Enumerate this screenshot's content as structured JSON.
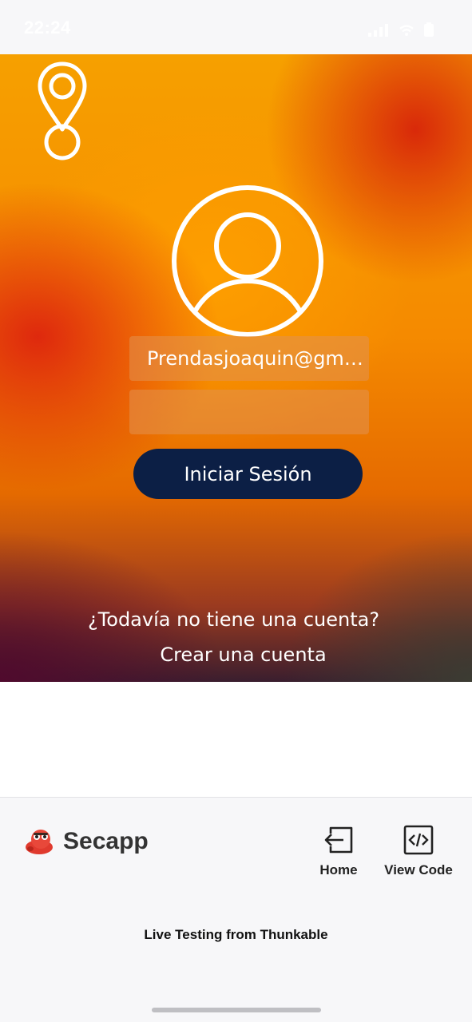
{
  "status_bar": {
    "time": "22:24"
  },
  "login": {
    "email_value": "Prendasjoaquin@gmai...",
    "password_value": "",
    "login_button_label": "Iniciar Sesión",
    "no_account_text": "¿Todavía no tiene una cuenta?",
    "create_account_label": "Crear una cuenta"
  },
  "thunkable_panel": {
    "app_name": "Secapp",
    "home_label": "Home",
    "view_code_label": "View Code",
    "footer_text": "Live Testing from Thunkable"
  },
  "colors": {
    "login_button": "#0c1f45",
    "gradient_orange": "#f6a000",
    "gradient_red": "#dc1e0f"
  }
}
